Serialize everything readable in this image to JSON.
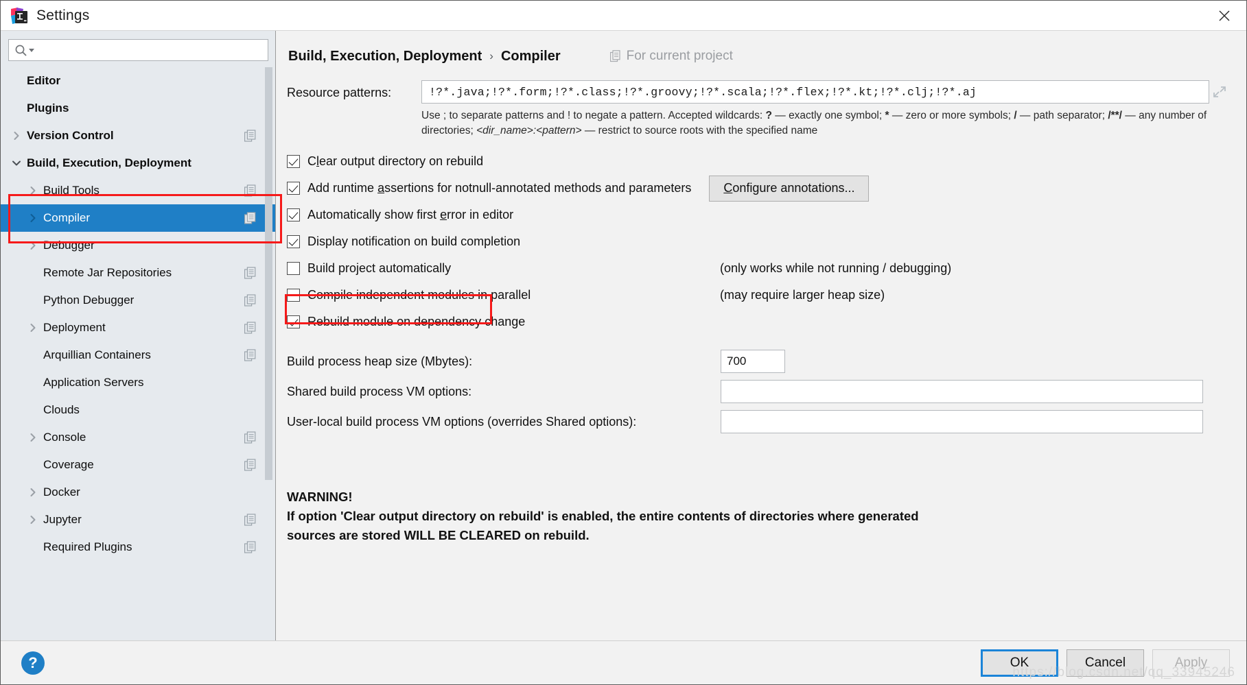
{
  "window": {
    "title": "Settings",
    "app_icon": "intellij-idea-logo",
    "close_icon": "close-icon"
  },
  "search": {
    "value": "",
    "placeholder": "",
    "icon": "search-icon",
    "dropdown_icon": "caret-down-icon"
  },
  "sidebar": {
    "scroll_thumb": {
      "top_pct": 0,
      "height_pct": 72
    },
    "items": [
      {
        "label": "Editor",
        "level": 0,
        "arrow": "none",
        "selected": false,
        "project_icon": false
      },
      {
        "label": "Plugins",
        "level": 0,
        "arrow": "none",
        "selected": false,
        "project_icon": false
      },
      {
        "label": "Version Control",
        "level": 0,
        "arrow": "collapsed",
        "selected": false,
        "project_icon": true
      },
      {
        "label": "Build, Execution, Deployment",
        "level": 0,
        "arrow": "expanded",
        "selected": false,
        "project_icon": false
      },
      {
        "label": "Build Tools",
        "level": 1,
        "arrow": "collapsed",
        "selected": false,
        "project_icon": true
      },
      {
        "label": "Compiler",
        "level": 1,
        "arrow": "collapsed",
        "selected": true,
        "project_icon": true
      },
      {
        "label": "Debugger",
        "level": 1,
        "arrow": "collapsed",
        "selected": false,
        "project_icon": false
      },
      {
        "label": "Remote Jar Repositories",
        "level": 1,
        "arrow": "none",
        "selected": false,
        "project_icon": true
      },
      {
        "label": "Python Debugger",
        "level": 1,
        "arrow": "none",
        "selected": false,
        "project_icon": true
      },
      {
        "label": "Deployment",
        "level": 1,
        "arrow": "collapsed",
        "selected": false,
        "project_icon": true
      },
      {
        "label": "Arquillian Containers",
        "level": 1,
        "arrow": "none",
        "selected": false,
        "project_icon": true
      },
      {
        "label": "Application Servers",
        "level": 1,
        "arrow": "none",
        "selected": false,
        "project_icon": false
      },
      {
        "label": "Clouds",
        "level": 1,
        "arrow": "none",
        "selected": false,
        "project_icon": false
      },
      {
        "label": "Console",
        "level": 1,
        "arrow": "collapsed",
        "selected": false,
        "project_icon": true
      },
      {
        "label": "Coverage",
        "level": 1,
        "arrow": "none",
        "selected": false,
        "project_icon": true
      },
      {
        "label": "Docker",
        "level": 1,
        "arrow": "collapsed",
        "selected": false,
        "project_icon": false
      },
      {
        "label": "Jupyter",
        "level": 1,
        "arrow": "collapsed",
        "selected": false,
        "project_icon": true
      },
      {
        "label": "Required Plugins",
        "level": 1,
        "arrow": "none",
        "selected": false,
        "project_icon": true
      }
    ]
  },
  "header": {
    "breadcrumb_parent": "Build, Execution, Deployment",
    "breadcrumb_sep": "›",
    "breadcrumb_current": "Compiler",
    "project_scope": "For current project",
    "project_scope_icon": "copy-module-icon"
  },
  "resource_patterns": {
    "label": "Resource patterns:",
    "value": "!?*.java;!?*.form;!?*.class;!?*.groovy;!?*.scala;!?*.flex;!?*.kt;!?*.clj;!?*.aj",
    "expand_icon": "expand-diagonal-icon",
    "hint_line1_a": "Use ; to separate patterns and ! to negate a pattern. Accepted wildcards: ",
    "hint_q": "?",
    "hint_line1_b": " — exactly one symbol; ",
    "hint_star": "*",
    "hint_line1_c": " — zero or more",
    "hint_line2_a": "symbols; ",
    "hint_slash": "/",
    "hint_line2_b": " — path separator; ",
    "hint_dstar": "/**/",
    "hint_line2_c": " — any number of directories; ",
    "hint_dirname": "<dir_name>:<pattern>",
    "hint_line2_d": " — restrict to source roots",
    "hint_line3": "with the specified name"
  },
  "options": [
    {
      "label_pre": "C",
      "mnemonic": "l",
      "label_post": "ear output directory on rebuild",
      "checked": true,
      "note": "",
      "button": null
    },
    {
      "label_pre": "Add runtime ",
      "mnemonic": "a",
      "label_post": "ssertions for notnull-annotated methods and parameters",
      "checked": true,
      "note": "",
      "button": {
        "label_pre": "",
        "mnemonic": "C",
        "label_post": "onfigure annotations..."
      }
    },
    {
      "label_pre": "Automatically show first ",
      "mnemonic": "e",
      "label_post": "rror in editor",
      "checked": true,
      "note": "",
      "button": null
    },
    {
      "label_pre": "Display notification on build completion",
      "mnemonic": "",
      "label_post": "",
      "checked": true,
      "note": "",
      "button": null
    },
    {
      "label_pre": "Build project automatically",
      "mnemonic": "",
      "label_post": "",
      "checked": false,
      "note": "(only works while not running / debugging)",
      "button": null
    },
    {
      "label_pre": "Compile independent modules in parallel",
      "mnemonic": "",
      "label_post": "",
      "checked": false,
      "note": "(may require larger heap size)",
      "button": null
    },
    {
      "label_pre": "Rebuild module on dependency change",
      "mnemonic": "",
      "label_post": "",
      "checked": true,
      "note": "",
      "button": null
    }
  ],
  "fields": [
    {
      "label": "Build process heap size (Mbytes):",
      "value": "700",
      "size": "small"
    },
    {
      "label": "Shared build process VM options:",
      "value": "",
      "size": "big"
    },
    {
      "label": "User-local build process VM options (overrides Shared options):",
      "value": "",
      "size": "big"
    }
  ],
  "warning": {
    "line1": "WARNING!",
    "line2": "If option 'Clear output directory on rebuild' is enabled, the entire contents of directories where generated",
    "line3": "sources are stored WILL BE CLEARED on rebuild."
  },
  "footer": {
    "help_label": "?",
    "ok_label": "OK",
    "cancel_label": "Cancel",
    "apply_label": "Apply"
  },
  "watermark": "https://blog.csdn.net/qq_33945246",
  "colors": {
    "accent": "#1f7fc6",
    "selection": "#1f7fc6",
    "annotation": "#f61a1a",
    "sidebar_bg": "#e6eaee",
    "pane_bg": "#f2f2f2"
  }
}
